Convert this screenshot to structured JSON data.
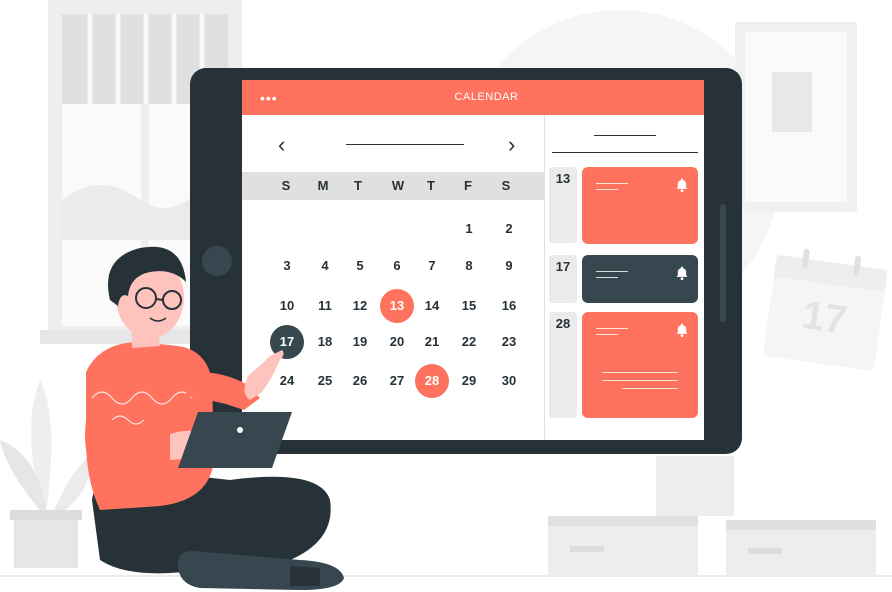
{
  "app": {
    "title": "CALENDAR",
    "menu_dots": "•••"
  },
  "calendar": {
    "prev_icon": "‹",
    "next_icon": "›",
    "weekdays": [
      "S",
      "M",
      "T",
      "W",
      "T",
      "F",
      "S"
    ],
    "weeks": [
      [
        "",
        "",
        "",
        "",
        "",
        "1",
        "2"
      ],
      [
        "3",
        "4",
        "5",
        "6",
        "7",
        "8",
        "9"
      ],
      [
        "10",
        "11",
        "12",
        "13",
        "14",
        "15",
        "16"
      ],
      [
        "17",
        "18",
        "19",
        "20",
        "21",
        "22",
        "23"
      ],
      [
        "24",
        "25",
        "26",
        "27",
        "28",
        "29",
        "30"
      ]
    ],
    "highlighted": {
      "13": "red",
      "28": "red",
      "17": "dark"
    }
  },
  "events": [
    {
      "date": "13",
      "color": "#ff725e",
      "icon": "bell-icon"
    },
    {
      "date": "17",
      "color": "#37474f",
      "icon": "bell-icon"
    },
    {
      "date": "28",
      "color": "#ff725e",
      "icon": "bell-icon"
    }
  ],
  "wall_calendar": {
    "day": "17"
  },
  "colors": {
    "accent": "#ff725e",
    "dark": "#37474f",
    "tablet_frame": "#263238",
    "background_shapes": "#f5f5f5"
  }
}
